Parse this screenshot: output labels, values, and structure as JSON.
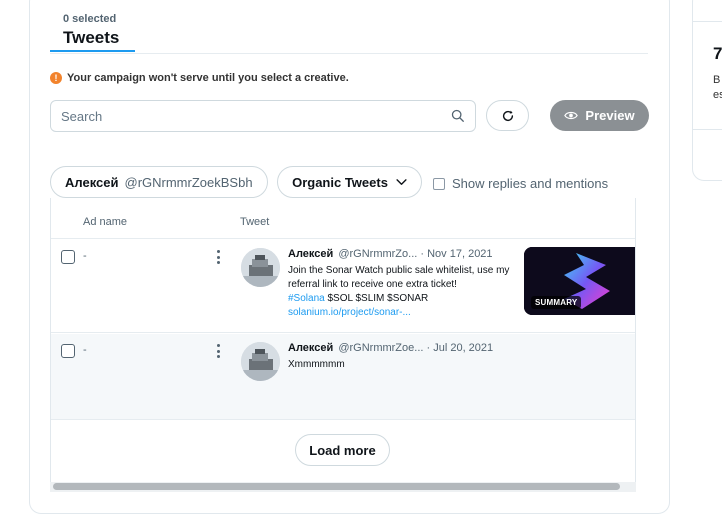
{
  "header": {
    "selected_count": "0 selected",
    "tab_label": "Tweets"
  },
  "alert": {
    "icon": "exclamation-icon",
    "text": "Your campaign won't serve until you select a creative."
  },
  "search": {
    "placeholder": "Search",
    "value": ""
  },
  "toolbar": {
    "refresh_icon": "refresh-icon",
    "preview_label": "Preview"
  },
  "filters": {
    "user_name": "Алексей",
    "user_handle": "@rGNrmmrZoekBSbh",
    "tweet_type": "Organic Tweets",
    "replies_label": "Show replies and mentions",
    "replies_checked": false
  },
  "table": {
    "columns": [
      "Ad name",
      "Tweet"
    ],
    "rows": [
      {
        "ad_name": "-",
        "author": "Алексей",
        "handle": "@rGNrmmrZo...",
        "date": "· Nov 17, 2021",
        "text": "Join the Sonar Watch public sale whitelist, use my referral link to receive one extra ticket!",
        "hashtag": "#Solana",
        "cashtags": "$SOL $SLIM $SONAR",
        "link": "solanium.io/project/sonar-...",
        "media_label": "SUMMARY"
      },
      {
        "ad_name": "-",
        "author": "Алексей",
        "handle": "@rGNrmmrZoe...",
        "date": "· Jul 20, 2021",
        "text": "Xmmmmmm"
      }
    ]
  },
  "footer": {
    "load_more_label": "Load more"
  },
  "side_panel": {
    "big_text": "7",
    "small_line1": "B",
    "small_line2": "es"
  },
  "colors": {
    "accent": "#1d9bf0",
    "warning": "#f2832c",
    "preview_button": "#8b9094"
  }
}
